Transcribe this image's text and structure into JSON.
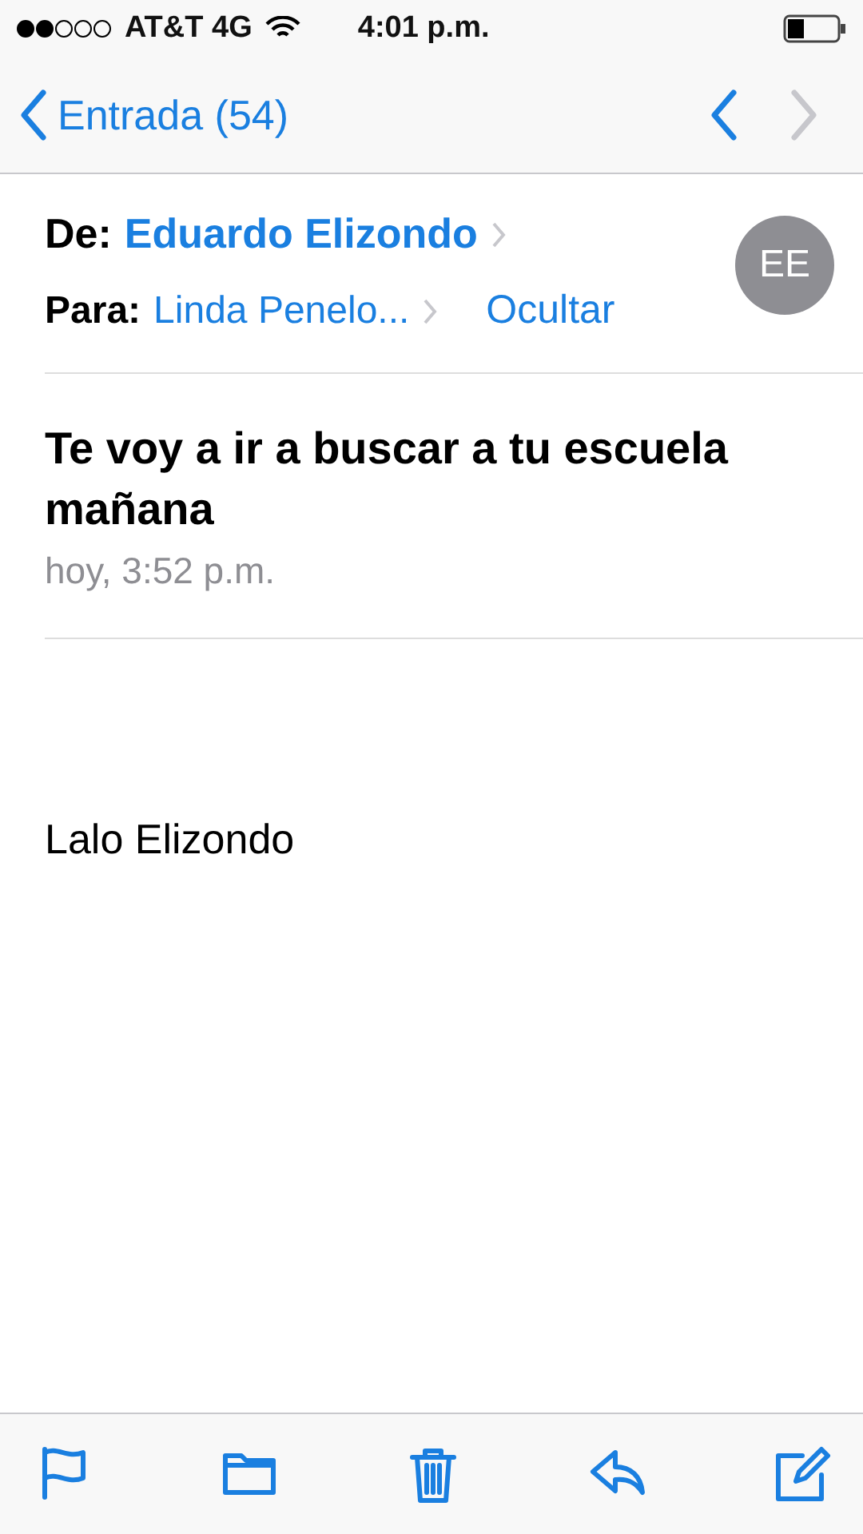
{
  "status_bar": {
    "carrier": "AT&T 4G",
    "time": "4:01 p.m."
  },
  "nav": {
    "back_label": "Entrada (54)",
    "arrows": [
      {
        "kind": "previous",
        "disabled": false
      },
      {
        "kind": "next",
        "disabled": true
      }
    ]
  },
  "header": {
    "from_label": "De:",
    "from": "Eduardo Elizondo",
    "to_label": "Para:",
    "to": "Linda Penelo...",
    "hide": "Ocultar",
    "avatar": "EE"
  },
  "subject": "Te voy a ir a buscar a tu escuela mañana",
  "date": "hoy, 3:52 p.m.",
  "body": "Lalo Elizondo",
  "toolbar": [
    {
      "kind": "flag"
    },
    {
      "kind": "folder"
    },
    {
      "kind": "trash"
    },
    {
      "kind": "reply"
    },
    {
      "kind": "compose"
    }
  ]
}
